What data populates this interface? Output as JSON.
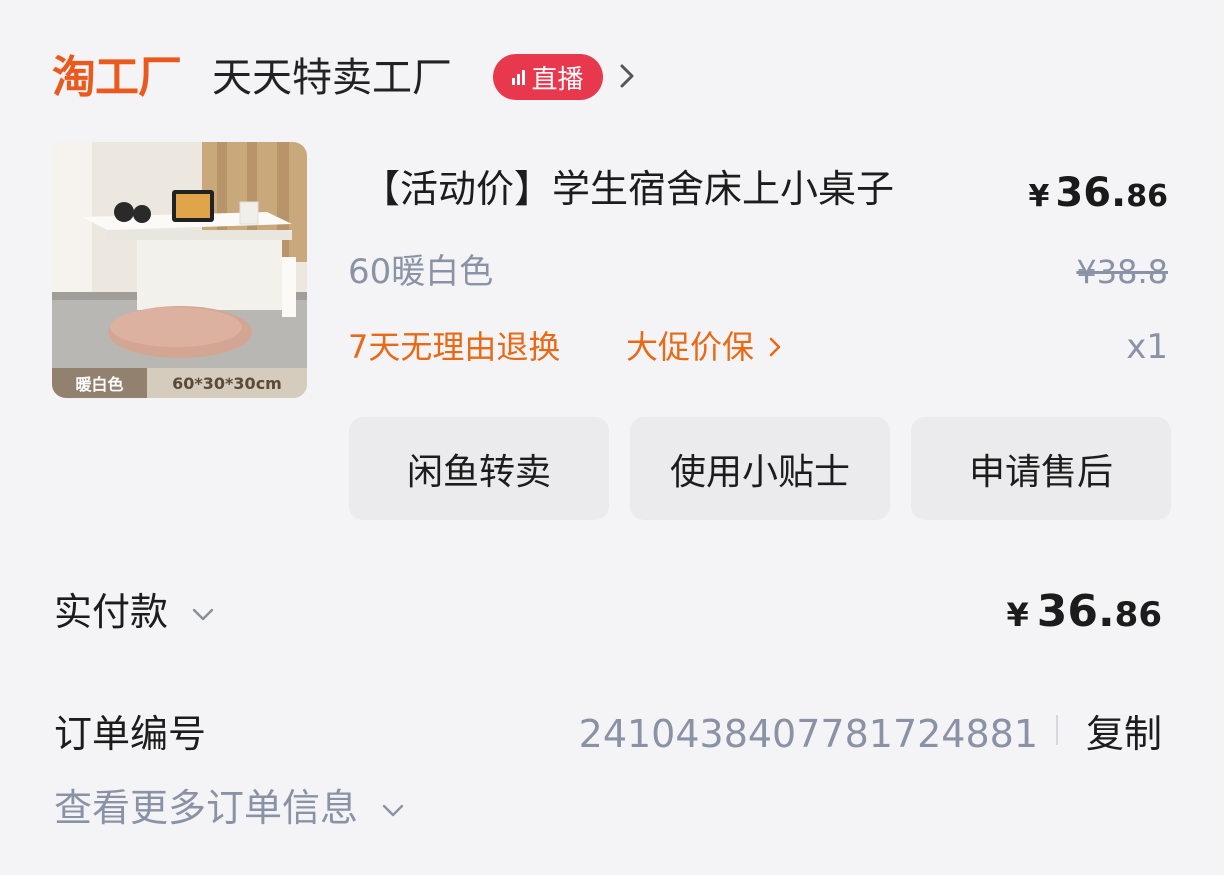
{
  "shop": {
    "logo_text": "淘工厂",
    "name": "天天特卖工厂",
    "live_badge": "直播",
    "brand_color": "#ea5a1e",
    "live_color": "#e8384d"
  },
  "product": {
    "image_tag": "暖白色",
    "image_size": "60*30*30cm",
    "title": "【活动价】学生宿舍床上小桌子",
    "price_symbol": "¥",
    "price_int": "36.",
    "price_dec": "86",
    "variant": "60暖白色",
    "original_price": "¥38.8",
    "promo_return": "7天无理由退换",
    "promo_guarantee": "大促价保",
    "quantity": "x1"
  },
  "actions": {
    "resell_label": "闲鱼转卖",
    "tips_label": "使用小贴士",
    "aftersale_label": "申请售后"
  },
  "payment": {
    "label": "实付款",
    "symbol": "¥",
    "amount_int": "36.",
    "amount_dec": "86"
  },
  "order": {
    "label": "订单编号",
    "number": "2410438407781724881",
    "copy_label": "复制",
    "more_label": "查看更多订单信息"
  },
  "colors": {
    "promo": "#e86a17",
    "muted": "#8a93a6",
    "button_bg": "#ebebed"
  }
}
